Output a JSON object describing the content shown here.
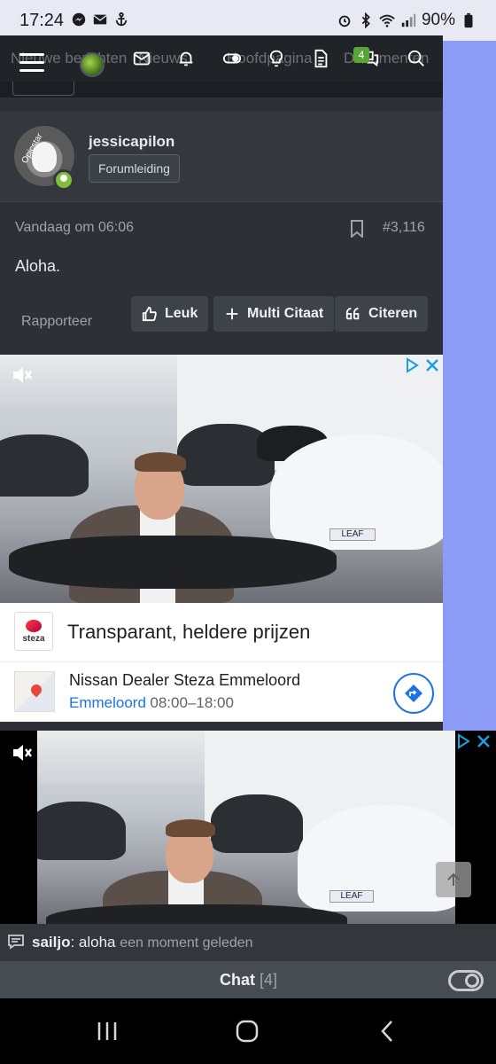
{
  "status_bar": {
    "time": "17:24",
    "battery": "90%"
  },
  "nav": {
    "ghost_items": [
      "Nieuwe berichten",
      "Nieuws",
      "Hoofdpagina",
      "Documenten"
    ],
    "conversations_badge": "4",
    "icons": [
      "menu-icon",
      "avatar",
      "inbox-icon",
      "bell-icon",
      "toggle-icon",
      "bulb-icon",
      "document-icon",
      "chat-bubbles-icon",
      "search-icon"
    ]
  },
  "post": {
    "avatar_text": "Opicstar",
    "username": "jessicapilon",
    "user_title": "Forumleiding",
    "date": "Vandaag om 06:06",
    "number": "#3,116",
    "body": "Aloha.",
    "report": "Rapporteer",
    "actions": {
      "like": "Leuk",
      "multiquote": "Multi Citaat",
      "quote": "Citeren"
    }
  },
  "ad1": {
    "logo_text": "steza",
    "headline": "Transparant, heldere prijzen",
    "dealer": "Nissan Dealer Steza Emmeloord",
    "city": "Emmeloord",
    "hours": "08:00–18:00",
    "car_plate": "LEAF"
  },
  "ad2": {
    "car_plate": "LEAF"
  },
  "chat": {
    "user": "sailjo",
    "message": ": aloha",
    "time": "een moment geleden",
    "label": "Chat",
    "count": "[4]"
  },
  "colors": {
    "accent_green": "#59a437",
    "link_blue": "#1a73e8",
    "page_bg": "#2d3036"
  }
}
